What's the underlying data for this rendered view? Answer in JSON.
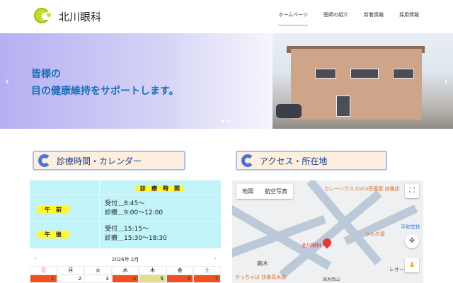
{
  "header": {
    "logo_text": "北川眼科",
    "nav": [
      "ホームページ",
      "医師の紹介",
      "新着情報",
      "採用情報"
    ]
  },
  "hero": {
    "line1": "皆様の",
    "line2": "目の健康維持をサポートします。",
    "prev": "‹",
    "next": "›"
  },
  "sections": {
    "hours_title": "診療時間・カレンダー",
    "access_title": "アクセス・所在地"
  },
  "hours": {
    "header": "診　療　時　間",
    "rows": [
      {
        "label": "午　前",
        "line1": "受付＿8:45～",
        "line2": "診療＿9:00～12:00"
      },
      {
        "label": "午　後",
        "line1": "受付＿15:15～",
        "line2": "診療＿15:30～18:30"
      }
    ]
  },
  "calendar": {
    "month": "2026年 2月",
    "prev": "‹",
    "next": "›",
    "weekdays": [
      "日",
      "月",
      "火",
      "水",
      "木",
      "金",
      "土"
    ],
    "days": [
      "1",
      "2",
      "3",
      "4",
      "5",
      "6",
      "7"
    ]
  },
  "map": {
    "type_map": "地図",
    "type_satellite": "航空写真",
    "marker_label": "北川眼科",
    "pois": [
      "カレーハウス CoCo壱番屋 扶桑店",
      "かんの屋",
      "やっちゃば 扶桑高木店",
      "高木",
      "レオー",
      "平和堂扶",
      "高木西山"
    ]
  }
}
